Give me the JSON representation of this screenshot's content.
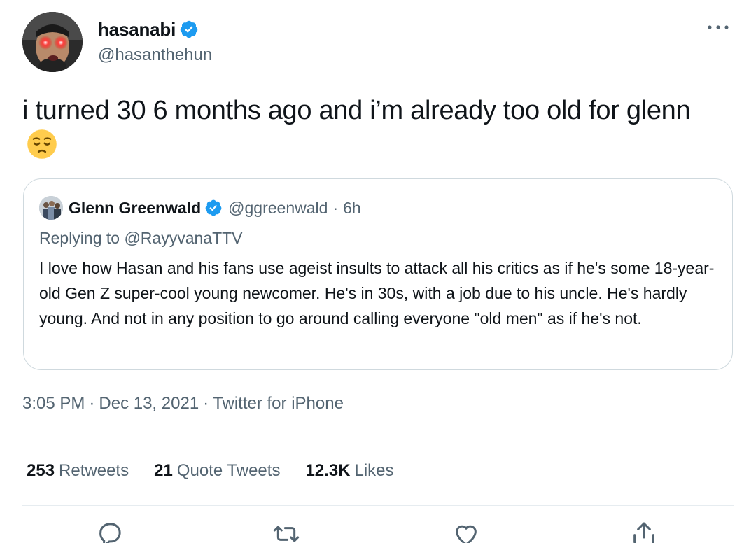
{
  "author": {
    "display_name": "hasanabi",
    "handle": "@hasanthehun"
  },
  "tweet": {
    "text": "i turned 30 6 months ago and i’m already too old for glenn",
    "emoji": "pensive-face"
  },
  "quoted_tweet": {
    "display_name": "Glenn Greenwald",
    "handle": "@ggreenwald",
    "separator": "·",
    "time_ago": "6h",
    "replying_to": "Replying to @RayyvanaTTV",
    "text": "I love how Hasan and his fans use ageist insults to attack all his critics as if he's some 18-year-old Gen Z super-cool young newcomer. He's in 30s, with a job due to his uncle. He's hardly young. And not in any position to go around calling everyone \"old men\" as if he's not."
  },
  "meta": {
    "time": "3:05 PM",
    "date": "Dec 13, 2021",
    "source": "Twitter for iPhone",
    "separator": "·"
  },
  "stats": {
    "retweets_count": "253",
    "retweets_label": "Retweets",
    "quotes_count": "21",
    "quotes_label": "Quote Tweets",
    "likes_count": "12.3K",
    "likes_label": "Likes"
  },
  "colors": {
    "verified_blue": "#1d9bf0",
    "secondary_text": "#536471",
    "primary_text": "#0f1419",
    "border": "#cfd9de"
  },
  "icons": [
    "verified-badge-icon",
    "more-icon",
    "reply-icon",
    "retweet-icon",
    "like-icon",
    "share-icon"
  ]
}
